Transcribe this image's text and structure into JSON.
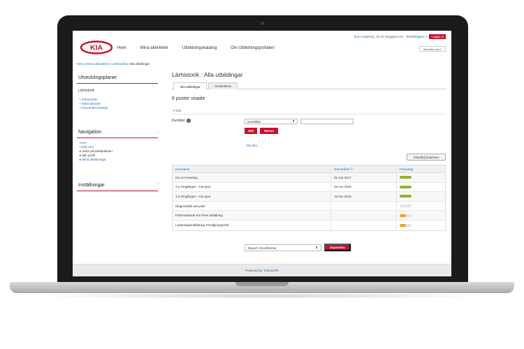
{
  "topbar": {
    "brand_link": "[Kia Academy]",
    "logged_in_text": "Du är inloggad som",
    "user_link": "Testdeltagare 1",
    "logout_label": "Logga ut",
    "language": "Svenska (sv) ◊"
  },
  "logo_text": "KIA",
  "nav": [
    "Hem",
    "Mina aktiviteter",
    "Utbildningskatalog",
    "Om Utbildningsportalen"
  ],
  "breadcrumb": {
    "items": [
      "Hem",
      "Mina aktiviteter",
      "Lärhistorik"
    ],
    "current": "Alla utbildingar"
  },
  "sidebar": {
    "section1_title": "Utvecklingsplaner",
    "section1_sub": "Lärhistorik",
    "section1_items": [
      "Allt lärande",
      "Aktivt lärande",
      "Genomfört lärande"
    ],
    "section2_title": "Navigation",
    "nav_home": "Hem",
    "nav_items": [
      "Mitt hem",
      "Sidor på webbplatsen",
      "Min profil",
      "Mina utbildningar"
    ],
    "section3_title": "Inställningar"
  },
  "main": {
    "title": "Lärhistorik : Alla utbildingar",
    "tabs": [
      "Alla utbildingar",
      "Annat Bevis"
    ],
    "count": "6 poster visade",
    "search_toggle": "Sök",
    "filter_label": "Kurstitel",
    "filter_operator": "innehåller",
    "search_button": "Sök",
    "clear_button": "Rensa",
    "show_more": "Visa fler...",
    "columns_button": "Visa/dölj kolumner"
  },
  "table": {
    "headers": [
      "Kursnamn",
      "Genomförd",
      "Framsteg"
    ],
    "rows": [
      {
        "name": "Kia on-boarding",
        "date": "01 sep 2017"
      },
      {
        "name": "2:a Omgången - Kia Quiz",
        "date": "25 nov 2015"
      },
      {
        "name": "1:a Omgången - Kia Quiz",
        "date": "13 nov 2015"
      },
      {
        "name": "Diagnostiskt test pilot",
        "date": ""
      },
      {
        "name": "Förberedande Kia Fleet utbildning",
        "date": ""
      },
      {
        "name": "Ledarskapsutbildning Försäljningschef",
        "date": ""
      }
    ],
    "progress": [
      {
        "value": 1.0,
        "color": "#8db52b"
      },
      {
        "value": 1.0,
        "color": "#8db52b"
      },
      {
        "value": 1.0,
        "color": "#8db52b"
      },
      {
        "value": 0.0,
        "color": "#e4e4e4"
      },
      {
        "value": 0.5,
        "color": "#f0a21c"
      },
      {
        "value": 0.5,
        "color": "#f0a21c"
      }
    ]
  },
  "export": {
    "format": "Export i Excelformat",
    "button": "Exportera"
  },
  "footer": {
    "text": "Powered by",
    "link": "TotaraLMS"
  },
  "colors": {
    "brand_red": "#c8102e",
    "link_blue": "#2b6cb0",
    "progress_done": "#8db52b",
    "progress_partial": "#f0a21c"
  }
}
